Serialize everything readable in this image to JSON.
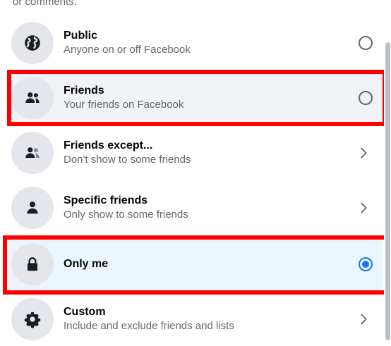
{
  "header": {
    "truncated_text": "or comments."
  },
  "options": [
    {
      "title": "Public",
      "description": "Anyone on or off Facebook",
      "icon": "globe-icon",
      "control": "radio",
      "checked": false
    },
    {
      "title": "Friends",
      "description": "Your friends on Facebook",
      "icon": "friends-icon",
      "control": "radio",
      "checked": false
    },
    {
      "title": "Friends except...",
      "description": "Don't show to some friends",
      "icon": "friends-except-icon",
      "control": "chevron"
    },
    {
      "title": "Specific friends",
      "description": "Only show to some friends",
      "icon": "person-icon",
      "control": "chevron"
    },
    {
      "title": "Only me",
      "description": "",
      "icon": "lock-icon",
      "control": "radio",
      "checked": true
    },
    {
      "title": "Custom",
      "description": "Include and exclude friends and lists",
      "icon": "gear-icon",
      "control": "chevron"
    }
  ],
  "colors": {
    "accent": "#1877f2",
    "highlight": "#ff0000",
    "secondary_text": "#65676b",
    "icon_bg": "#e4e6eb",
    "selected_bg": "#ebf5ff"
  }
}
